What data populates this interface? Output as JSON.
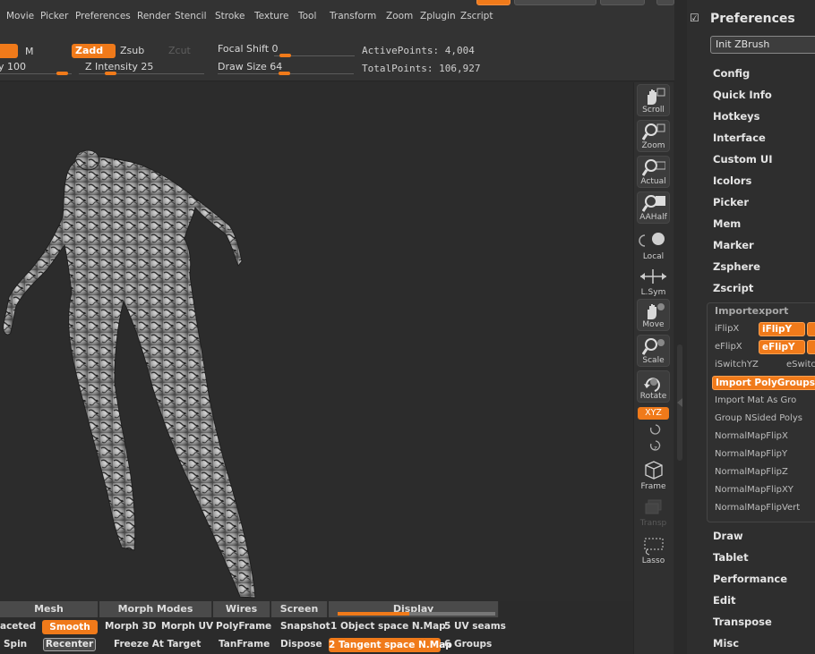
{
  "menu": {
    "items": [
      "Movie",
      "Picker",
      "Preferences",
      "Render",
      "Stencil",
      "Stroke",
      "Texture",
      "Tool",
      "Transform",
      "Zoom",
      "Zplugin",
      "Zscript"
    ]
  },
  "shelf": {
    "m_label": "M",
    "zadd": "Zadd",
    "zsub": "Zsub",
    "zcut": "Zcut",
    "intensity_label": "y 100",
    "z_intensity": "Z Intensity 25",
    "focal_shift": "Focal Shift 0",
    "draw_size": "Draw Size 64",
    "active_points": "ActivePoints: 4,004",
    "total_points": "TotalPoints: 106,927"
  },
  "strip": {
    "scroll": "Scroll",
    "zoom": "Zoom",
    "actual": "Actual",
    "aahalf": "AAHalf",
    "local": "Local",
    "lsym": "L.Sym",
    "move": "Move",
    "scale": "Scale",
    "rotate": "Rotate",
    "xyz": "XYZ",
    "frame": "Frame",
    "transp": "Transp",
    "lasso": "Lasso"
  },
  "preferences": {
    "title": "Preferences",
    "init": "Init ZBrush",
    "sections_top": [
      "Config",
      "Quick Info",
      "Hotkeys",
      "Interface",
      "Custom UI",
      "Icolors",
      "Picker",
      "Mem",
      "Marker",
      "Zsphere",
      "Zscript"
    ],
    "importexport": {
      "header": "Importexport",
      "iflipx": "iFlipX",
      "iflipy": "iFlipY",
      "eflipx": "eFlipX",
      "eflipy": "eFlipY",
      "iswitchyz": "iSwitchYZ",
      "eswitch": "eSwitc",
      "import_polygroups": "Import PolyGroups",
      "import_mat": "Import Mat As Gro",
      "group_nsided": "Group NSided Polys",
      "normalmapflipx": "NormalMapFlipX",
      "normalmapflipy": "NormalMapFlipY",
      "normalmapflipz": "NormalMapFlipZ",
      "normalmapflipxy": "NormalMapFlipXY",
      "normalmapflipvert": "NormalMapFlipVert"
    },
    "sections_bottom": [
      "Draw",
      "Tablet",
      "Performance",
      "Edit",
      "Transpose",
      "Misc"
    ]
  },
  "bottom": {
    "headers": {
      "mesh": "Mesh",
      "morph_modes": "Morph Modes",
      "wires": "Wires",
      "screen": "Screen",
      "display": "Display"
    },
    "faceted": "aceted",
    "smooth": "Smooth",
    "morph3d": "Morph 3D",
    "morphuv": "Morph UV",
    "polyframe": "PolyFrame",
    "snapshot": "Snapshot",
    "object_space": "1 Object space N.Map",
    "uv_seams": "5 UV seams",
    "spin": "Spin",
    "recenter": "Recenter",
    "freeze": "Freeze At Target",
    "tanframe": "TanFrame",
    "dispose": "Dispose",
    "tangent_space": "2 Tangent space N.Map",
    "groups": "6 Groups"
  },
  "colors": {
    "accent": "#f07a1a",
    "background": "#2b2b2b"
  }
}
